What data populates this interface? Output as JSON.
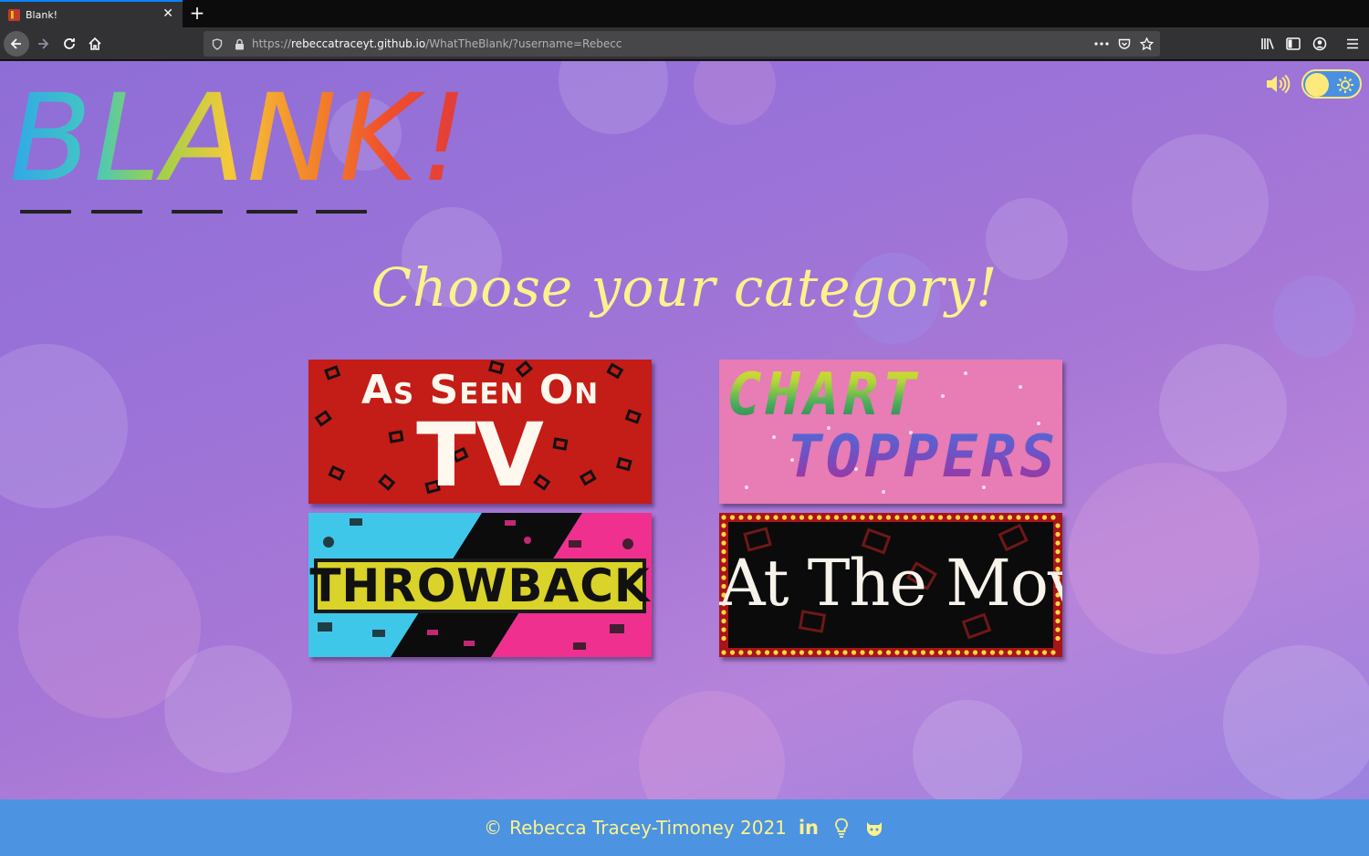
{
  "browser": {
    "tab_title": "Blank!",
    "tab_close": "✕",
    "new_tab": "+",
    "url_prefix": "https://",
    "url_host": "rebeccatraceyt.github.io",
    "url_path": "/WhatTheBlank/?username=Rebecc"
  },
  "header": {
    "logo_text": "BLANK!",
    "logo_dashes": 5
  },
  "main": {
    "heading": "Choose your category!",
    "categories": [
      {
        "line1": "As Seen On",
        "line2": "TV",
        "name": "as-seen-on-tv"
      },
      {
        "line1": "CHART",
        "line2": "TOPPERS",
        "name": "chart-toppers"
      },
      {
        "line1": "THROWBACK",
        "name": "throwback"
      },
      {
        "line1": "At The Movies",
        "name": "at-the-movies"
      }
    ]
  },
  "footer": {
    "copyright_symbol": "©",
    "text": "Rebecca Tracey-Timoney 2021",
    "linkedin": "in"
  },
  "colors": {
    "accent_yellow": "#fbf28d",
    "footer_blue": "#4c93e2",
    "toggle_blue": "#4a90e2"
  },
  "icons": [
    "back-arrow-icon",
    "forward-arrow-icon",
    "reload-icon",
    "home-icon",
    "shield-icon",
    "lock-icon",
    "more-icon",
    "pocket-icon",
    "bookmark-star-icon",
    "library-icon",
    "sidebar-icon",
    "account-icon",
    "menu-icon",
    "speaker-icon",
    "sun-icon",
    "linkedin-icon",
    "lightbulb-icon",
    "github-icon"
  ]
}
